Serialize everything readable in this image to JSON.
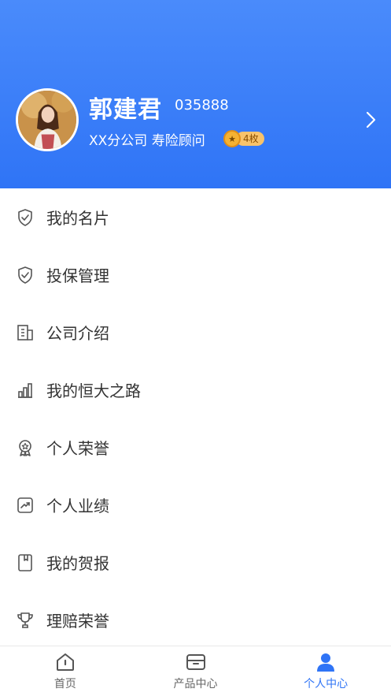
{
  "profile": {
    "name": "郭建君",
    "code": "035888",
    "subtitle": "XX分公司  寿险顾问",
    "badge_count": "4枚"
  },
  "menu": [
    {
      "label": "我的名片",
      "icon": "shield-check-icon"
    },
    {
      "label": "投保管理",
      "icon": "shield-check-icon"
    },
    {
      "label": "公司介绍",
      "icon": "building-icon"
    },
    {
      "label": "我的恒大之路",
      "icon": "bar-chart-icon"
    },
    {
      "label": "个人荣誉",
      "icon": "award-icon"
    },
    {
      "label": "个人业绩",
      "icon": "trend-icon"
    },
    {
      "label": "我的贺报",
      "icon": "bookmark-icon"
    },
    {
      "label": "理赔荣誉",
      "icon": "trophy-icon"
    }
  ],
  "tabs": [
    {
      "label": "首页",
      "icon": "home-icon"
    },
    {
      "label": "产品中心",
      "icon": "box-icon"
    },
    {
      "label": "个人中心",
      "icon": "person-icon"
    }
  ],
  "colors": {
    "primary": "#2f74f6",
    "icon_gray": "#555555"
  }
}
